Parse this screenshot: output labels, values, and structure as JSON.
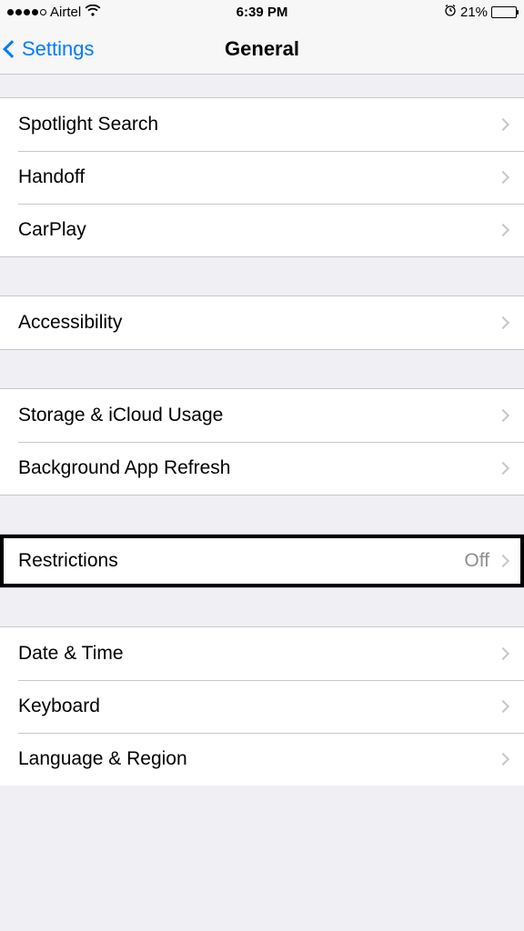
{
  "status_bar": {
    "carrier": "Airtel",
    "time": "6:39 PM",
    "battery_percent": "21%"
  },
  "nav": {
    "back_label": "Settings",
    "title": "General"
  },
  "groups": [
    {
      "rows": [
        {
          "label": "Spotlight Search"
        },
        {
          "label": "Handoff"
        },
        {
          "label": "CarPlay"
        }
      ]
    },
    {
      "rows": [
        {
          "label": "Accessibility"
        }
      ]
    },
    {
      "rows": [
        {
          "label": "Storage & iCloud Usage"
        },
        {
          "label": "Background App Refresh"
        }
      ]
    },
    {
      "highlight": true,
      "rows": [
        {
          "label": "Restrictions",
          "detail": "Off"
        }
      ]
    },
    {
      "rows": [
        {
          "label": "Date & Time"
        },
        {
          "label": "Keyboard"
        },
        {
          "label": "Language & Region"
        }
      ]
    }
  ]
}
